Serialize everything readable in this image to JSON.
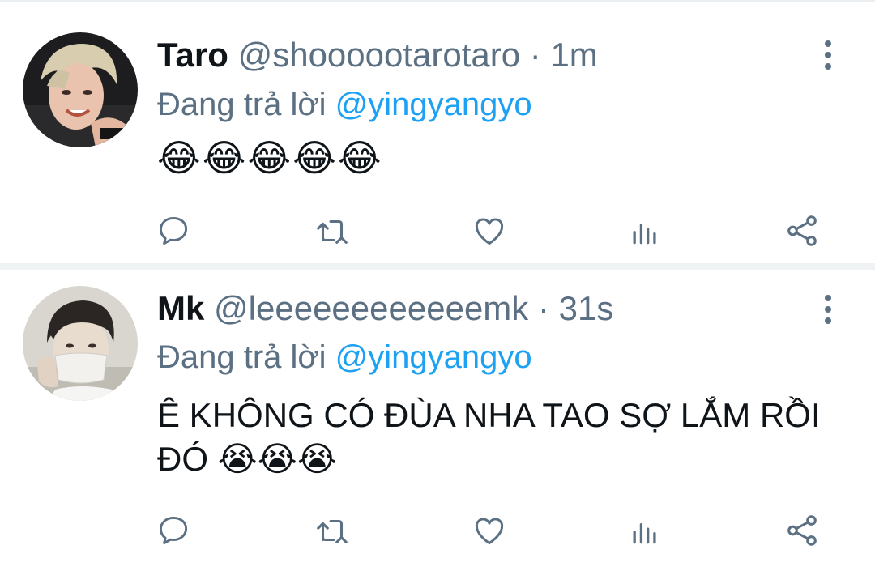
{
  "tweets": [
    {
      "name": "Taro",
      "handle": "@shoooootarotaro",
      "separator": "·",
      "time": "1m",
      "reply_prefix": "Đang trả lời",
      "reply_to": "@yingyangyo",
      "text": "😂😂😂😂😂"
    },
    {
      "name": "Mk",
      "handle": "@leeeeeeeeeeeemk",
      "separator": "·",
      "time": "31s",
      "reply_prefix": "Đang trả lời",
      "reply_to": "@yingyangyo",
      "text": "Ê KHÔNG CÓ ĐÙA NHA TAO SỢ LẮM RỒI ĐÓ 😭😭😭"
    }
  ],
  "icons": {
    "more": "more-vertical-icon",
    "reply": "reply-icon",
    "retweet": "retweet-icon",
    "like": "heart-icon",
    "analytics": "analytics-icon",
    "share": "share-icon"
  },
  "colors": {
    "link": "#1da1f2",
    "secondary_text": "#5b7083",
    "primary_text": "#0f1419",
    "divider": "#eff3f4"
  }
}
